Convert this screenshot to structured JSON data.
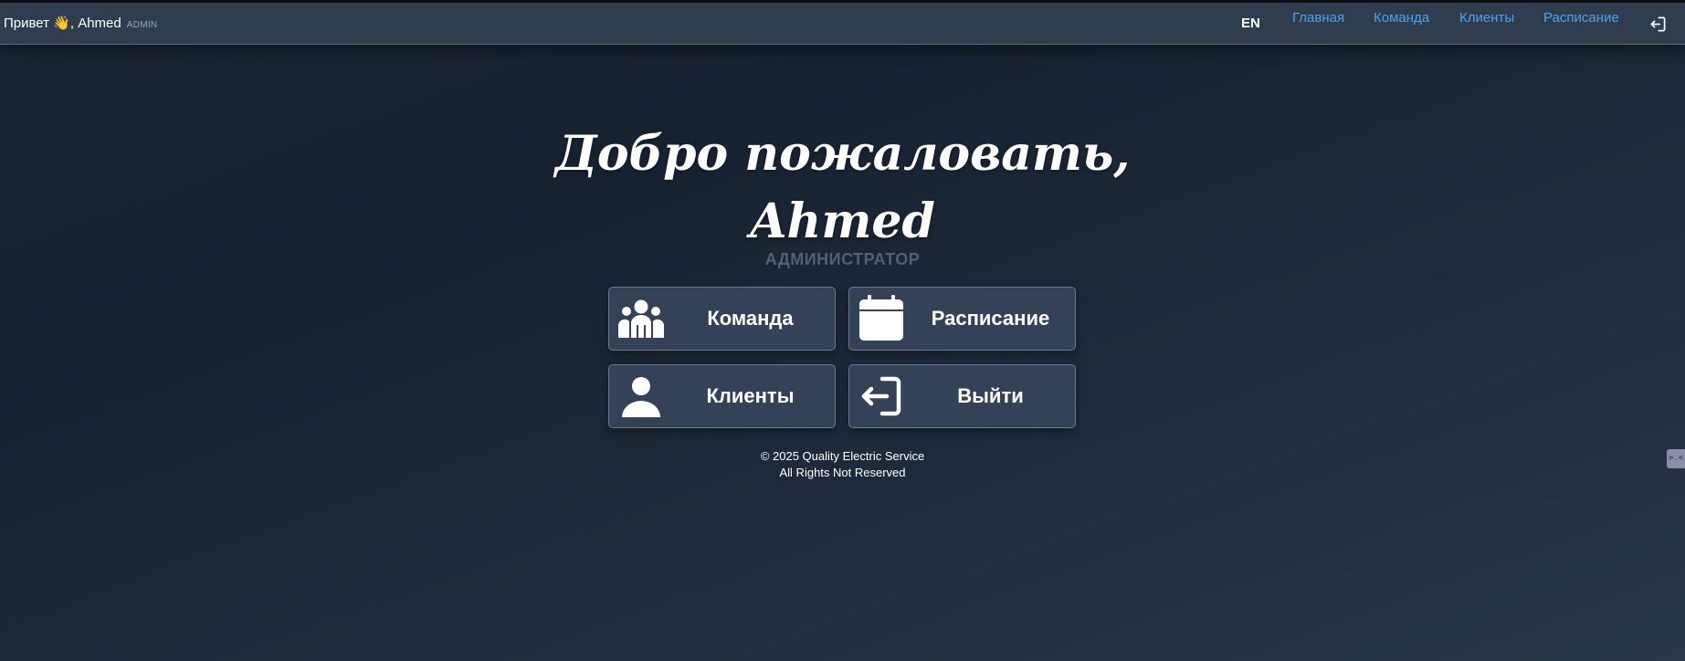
{
  "navbar": {
    "greeting": "Привет 👋, Ahmed",
    "role_badge": "ADMIN",
    "lang": "EN",
    "links": [
      {
        "label": "Главная"
      },
      {
        "label": "Команда"
      },
      {
        "label": "Клиенты"
      },
      {
        "label": "Расписание"
      }
    ],
    "logout_icon": "logout-icon",
    "link_color": "#4aa3f0"
  },
  "hero": {
    "welcome_line1": "Добро пожаловать,",
    "welcome_line2": "Ahmed",
    "role": "АДМИНИСТРАТОР"
  },
  "cards": [
    {
      "label": "Команда",
      "icon": "team-icon"
    },
    {
      "label": "Расписание",
      "icon": "calendar-icon"
    },
    {
      "label": "Клиенты",
      "icon": "user-icon"
    },
    {
      "label": "Выйти",
      "icon": "logout-icon"
    }
  ],
  "footer": {
    "copyright": "© 2025 Quality Electric Service",
    "rights": "All Rights Not Reserved"
  },
  "side_widget": {
    "text": ">.<"
  },
  "colors": {
    "navbar_bg": "#2f3d4f",
    "card_bg": "#334256",
    "page_bg": "#1b2634"
  }
}
